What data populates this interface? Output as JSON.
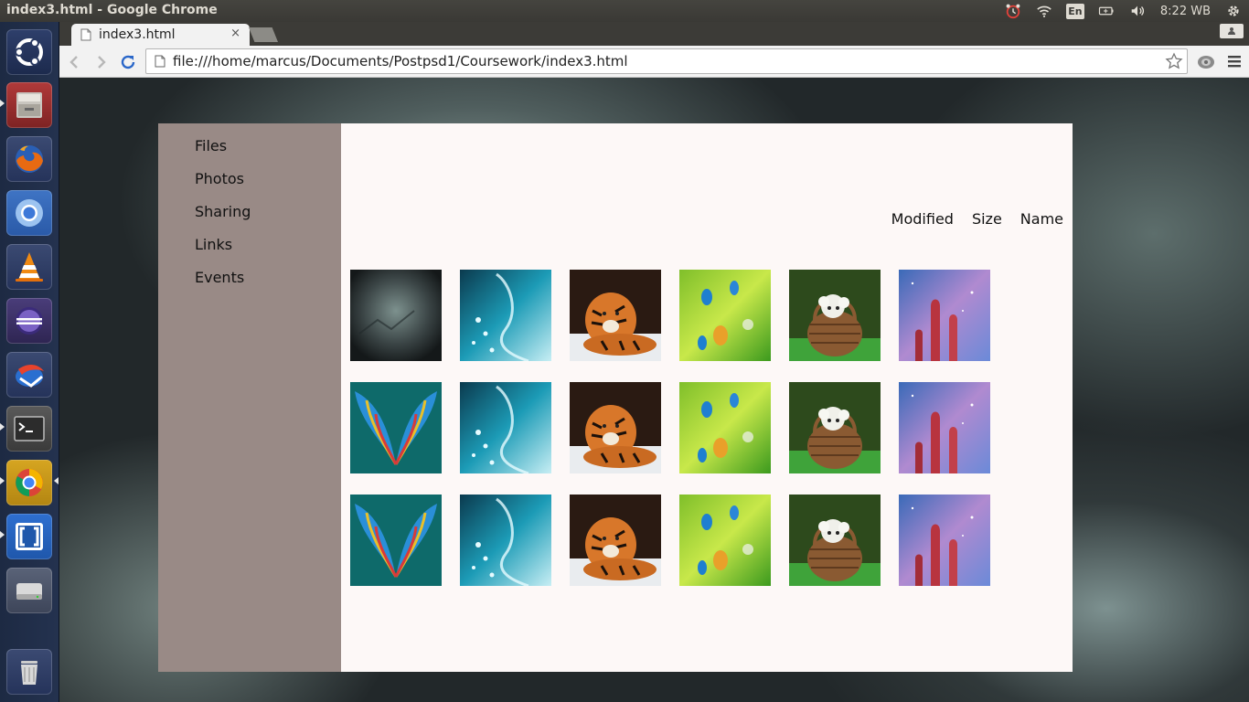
{
  "top_panel": {
    "window_title": "index3.html - Google Chrome",
    "keyboard_layout": "En",
    "clock": "8:22 WB",
    "indicator_icons": [
      "alarm-clock-icon",
      "wifi-icon",
      "keyboard-icon",
      "battery-icon",
      "volume-icon",
      "settings-gear-icon"
    ]
  },
  "launcher": {
    "items": [
      "ubuntu-dash",
      "files",
      "firefox",
      "chromium",
      "vlc",
      "eclipse",
      "thunderbird-style-app",
      "terminal",
      "google-chrome",
      "brackets",
      "disk-drive",
      "trash"
    ]
  },
  "browser": {
    "tab_title": "index3.html",
    "tab_close": "×",
    "url": "file:///home/marcus/Documents/Postpsd1/Coursework/index3.html"
  },
  "page": {
    "nav": [
      {
        "label": "Files"
      },
      {
        "label": "Photos"
      },
      {
        "label": "Sharing"
      },
      {
        "label": "Links"
      },
      {
        "label": "Events"
      }
    ],
    "sort_options": [
      {
        "label": "Modified"
      },
      {
        "label": "Size"
      },
      {
        "label": "Name"
      }
    ],
    "thumbnails": [
      [
        "dark-grunge-texture",
        "blue-water-jellyfish",
        "tiger-in-snow",
        "kingfisher-birds",
        "puppy-in-basket",
        "pillars-of-creation-nebula"
      ],
      [
        "macaw-wings",
        "blue-water-jellyfish",
        "tiger-in-snow",
        "kingfisher-birds",
        "puppy-in-basket",
        "pillars-of-creation-nebula"
      ],
      [
        "macaw-wings",
        "blue-water-jellyfish",
        "tiger-in-snow",
        "kingfisher-birds",
        "puppy-in-basket",
        "pillars-of-creation-nebula"
      ]
    ]
  }
}
